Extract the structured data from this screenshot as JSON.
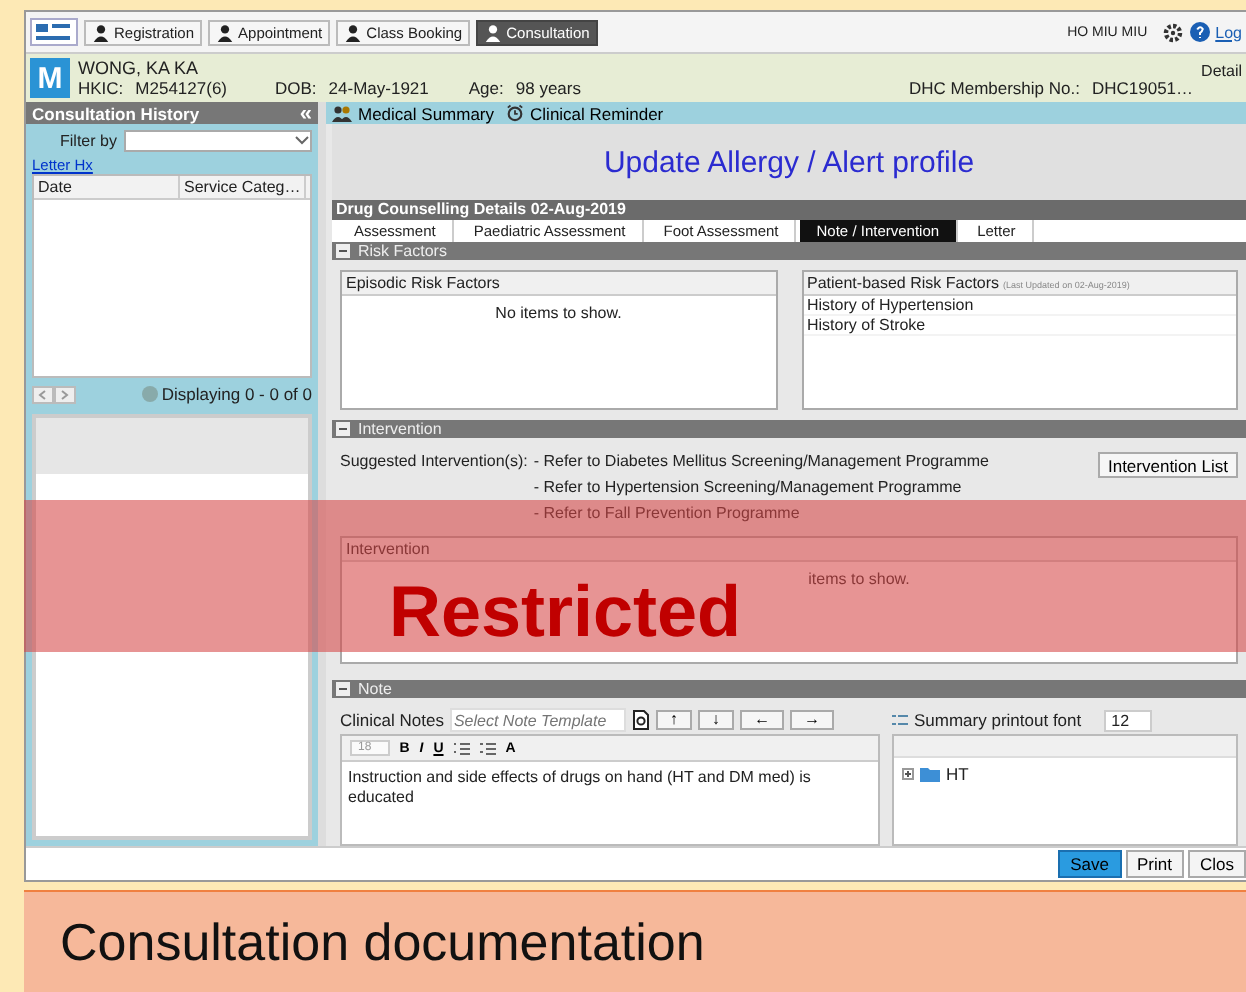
{
  "nav": {
    "tabs": [
      {
        "label": "Registration",
        "selected": false
      },
      {
        "label": "Appointment",
        "selected": false
      },
      {
        "label": "Class Booking",
        "selected": false
      },
      {
        "label": "Consultation",
        "selected": true
      }
    ],
    "user": "HO MIU MIU",
    "logout": "Log"
  },
  "patient": {
    "initial": "M",
    "name": "WONG, KA KA",
    "hkic_label": "HKIC:",
    "hkic": "M254127(6)",
    "dob_label": "DOB:",
    "dob": "24-May-1921",
    "age_label": "Age:",
    "age": "98 years",
    "membership_label": "DHC Membership No.:",
    "membership": "DHC19051…",
    "detail": "Detail"
  },
  "history": {
    "title": "Consultation History",
    "collapse": "«",
    "filter_label": "Filter by",
    "letter_link": "Letter Hx",
    "columns": [
      "Date",
      "Service Categ…"
    ],
    "pager": "Displaying 0 - 0 of 0"
  },
  "toolbar": [
    {
      "label": "Medical Summary",
      "kind": "people"
    },
    {
      "label": "Clinical Reminder",
      "kind": "alarm"
    }
  ],
  "title": "Update Allergy / Alert profile",
  "details": {
    "header": "Drug Counselling Details 02-Aug-2019",
    "tabs": [
      {
        "label": "Assessment",
        "selected": false
      },
      {
        "label": "Paediatric Assessment",
        "selected": false
      },
      {
        "label": "Foot Assessment",
        "selected": false
      },
      {
        "label": "Note / Intervention",
        "selected": true
      },
      {
        "label": "Letter",
        "selected": false
      }
    ]
  },
  "risk": {
    "header": "Risk Factors",
    "episodic_title": "Episodic Risk Factors",
    "episodic_empty": "No items to show.",
    "patient_title": "Patient-based Risk Factors",
    "patient_note": "(Last Updated on 02-Aug-2019)",
    "patient_items": [
      "History of Hypertension",
      "History of Stroke"
    ]
  },
  "intervention": {
    "header": "Intervention",
    "label": "Suggested Intervention(s):",
    "items": [
      "- Refer to Diabetes Mellitus Screening/Management Programme",
      "- Refer to Hypertension Screening/Management Programme",
      "- Refer to Fall Prevention Programme"
    ],
    "button": "Intervention List",
    "table_title": "Intervention",
    "empty": "items to show."
  },
  "note": {
    "header": "Note",
    "label": "Clinical Notes",
    "template_placeholder": "Select Note Template",
    "arrows": [
      "↑",
      "↓",
      "←",
      "→"
    ],
    "font_label": "Summary printout font",
    "font_size": "12",
    "editor_size": "18",
    "format_buttons": [
      "B",
      "I",
      "U"
    ],
    "color_button": "A",
    "text": "Instruction and side effects of drugs on hand (HT and DM med) is educated",
    "tree": [
      {
        "label": "HT",
        "expanded": false
      }
    ]
  },
  "buttons": [
    {
      "label": "Save",
      "primary": true
    },
    {
      "label": "Print",
      "primary": false
    },
    {
      "label": "Clos",
      "primary": false
    }
  ],
  "overlay": "Restricted",
  "caption": "Consultation documentation"
}
